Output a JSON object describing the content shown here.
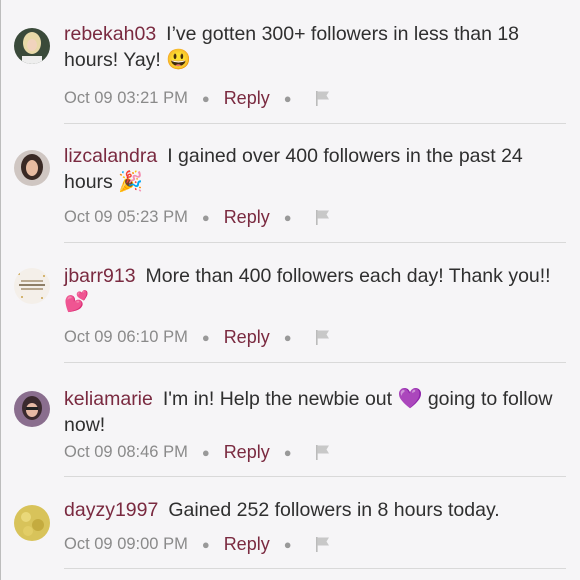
{
  "comments": [
    {
      "username": "rebekah03",
      "text": "I’ve gotten 300+ followers in less than 18 hours! Yay!",
      "emoji": "😃",
      "timestamp": "Oct 09 03:21 PM",
      "reply_label": "Reply",
      "avatar_icon": "user-avatar-icon",
      "flag_icon": "flag-icon"
    },
    {
      "username": "lizcalandra",
      "text": "I gained over 400 followers in the past 24 hours",
      "emoji": "🎉",
      "timestamp": "Oct 09 05:23 PM",
      "reply_label": "Reply",
      "avatar_icon": "user-avatar-icon",
      "flag_icon": "flag-icon"
    },
    {
      "username": "jbarr913",
      "text": "More than 400 followers each day! Thank you!!",
      "emoji": "💕",
      "timestamp": "Oct 09 06:10 PM",
      "reply_label": "Reply",
      "avatar_icon": "user-avatar-icon",
      "flag_icon": "flag-icon"
    },
    {
      "username": "keliamarie",
      "text_before": "I'm in! Help the newbie out",
      "emoji": "💜",
      "text_after": "going to follow now!",
      "timestamp": "Oct 09 08:46 PM",
      "reply_label": "Reply",
      "avatar_icon": "user-avatar-icon",
      "flag_icon": "flag-icon"
    },
    {
      "username": "dayzy1997",
      "text": "Gained 252 followers in 8 hours today.",
      "timestamp": "Oct 09 09:00 PM",
      "reply_label": "Reply",
      "avatar_icon": "user-avatar-icon",
      "flag_icon": "flag-icon"
    }
  ],
  "colors": {
    "username": "#7a2a40",
    "reply": "#7a2a40",
    "meta": "#8a8a8a",
    "background": "#f6f5f7"
  }
}
